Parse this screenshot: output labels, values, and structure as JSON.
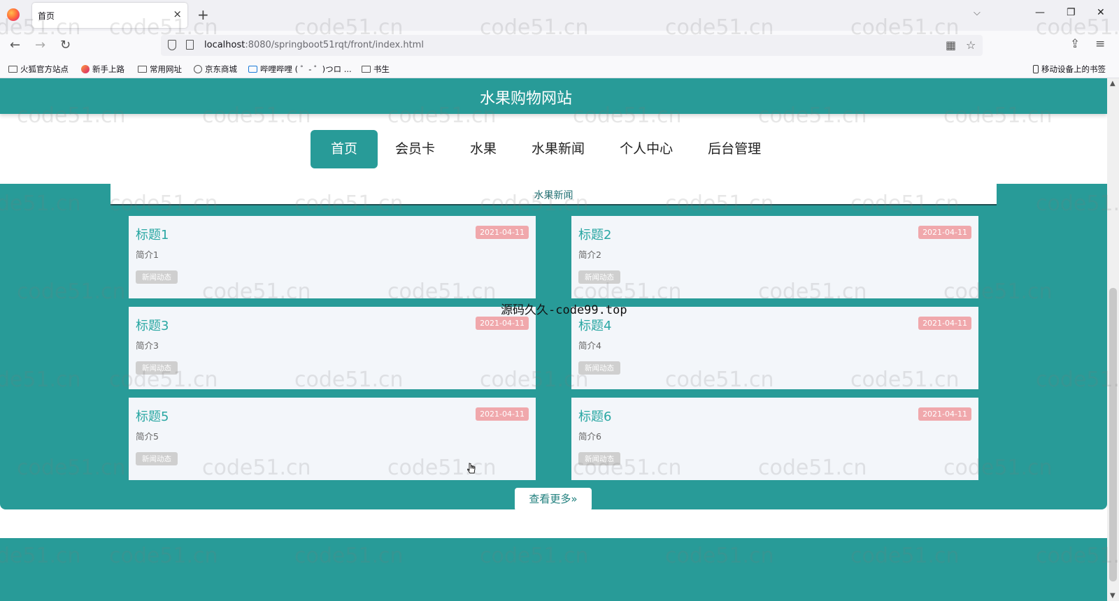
{
  "browser": {
    "tab_title": "首页",
    "tab_close": "×",
    "new_tab": "+",
    "tab_overflow": "⌵",
    "window_controls": [
      "—",
      "❐",
      "✕"
    ],
    "url_host": "localhost",
    "url_path": ":8080/springboot51rqt/front/index.html",
    "bookmarks": [
      "火狐官方站点",
      "新手上路",
      "常用网址",
      "京东商城",
      "哔哩哔哩 ( ゜- ゜)つロ ...",
      "书生"
    ],
    "mobile_bookmarks": "移动设备上的书签"
  },
  "site": {
    "title": "水果购物网站",
    "menu": [
      "首页",
      "会员卡",
      "水果",
      "水果新闻",
      "个人中心",
      "后台管理"
    ],
    "active_menu": "首页",
    "section_title": "水果新闻",
    "more_button": "查看更多»",
    "news": [
      {
        "title": "标题1",
        "date": "2021-04-11",
        "intro": "简介1",
        "tag": "新闻动态"
      },
      {
        "title": "标题2",
        "date": "2021-04-11",
        "intro": "简介2",
        "tag": "新闻动态"
      },
      {
        "title": "标题3",
        "date": "2021-04-11",
        "intro": "简介3",
        "tag": "新闻动态"
      },
      {
        "title": "标题4",
        "date": "2021-04-11",
        "intro": "简介4",
        "tag": "新闻动态"
      },
      {
        "title": "标题5",
        "date": "2021-04-11",
        "intro": "简介5",
        "tag": "新闻动态"
      },
      {
        "title": "标题6",
        "date": "2021-04-11",
        "intro": "简介6",
        "tag": "新闻动态"
      }
    ]
  },
  "overlay": {
    "watermark": "code51.cn",
    "center_mark": "源码久久-code99.top"
  },
  "colors": {
    "brand": "#289b98",
    "date_badge": "#f0a8ac",
    "card_bg": "#f3f6fa",
    "title_link": "#2aa7a3"
  }
}
